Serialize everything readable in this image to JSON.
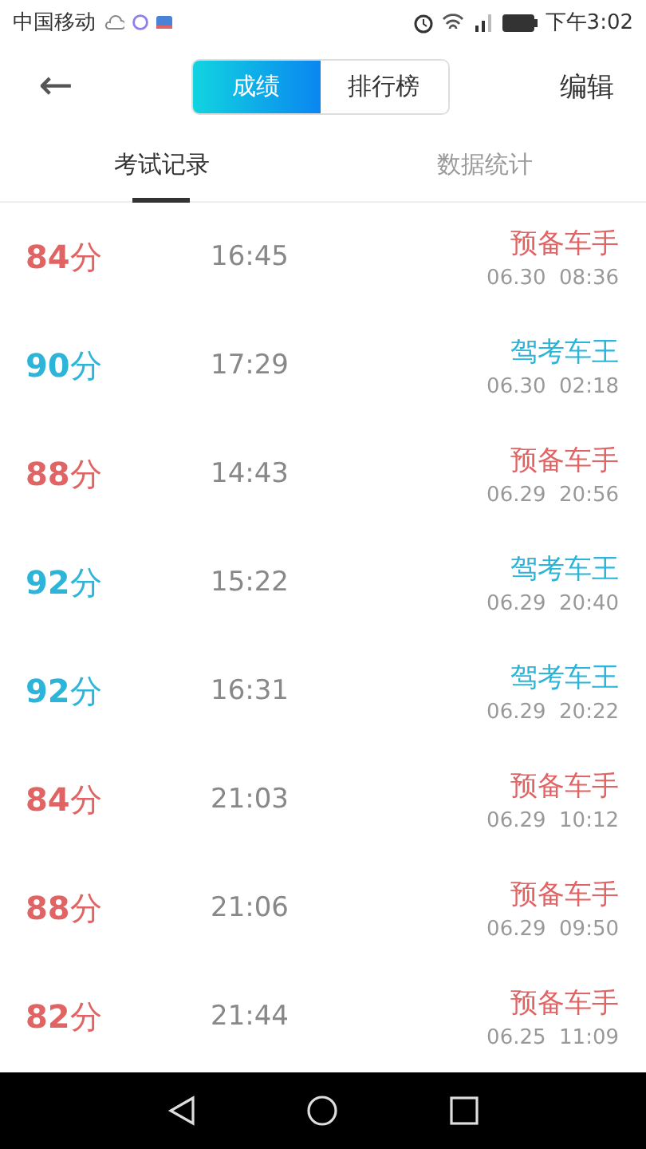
{
  "status_bar": {
    "carrier": "中国移动",
    "time": "下午3:02"
  },
  "header": {
    "back": "←",
    "segments": [
      {
        "label": "成绩",
        "selected": true
      },
      {
        "label": "排行榜",
        "selected": false
      }
    ],
    "action": "编辑"
  },
  "tabs": [
    {
      "label": "考试记录",
      "selected": true
    },
    {
      "label": "数据统计",
      "selected": false
    }
  ],
  "records": [
    {
      "score": "**84**分",
      "duration": "16:45",
      "title": "预备车手",
      "date": "06.30  08:36",
      "color": "#e06464"
    },
    {
      "score": "**90**分",
      "duration": "17:29",
      "title": "驾考车王",
      "date": "06.30  02:18",
      "color": "#2db4d9"
    },
    {
      "score": "**88**分",
      "duration": "14:43",
      "title": "预备车手",
      "date": "06.29  20:56",
      "color": "#e06464"
    },
    {
      "score": "**92**分",
      "duration": "15:22",
      "title": "驾考车王",
      "date": "06.29  20:40",
      "color": "#2db4d9"
    },
    {
      "score": "**92**分",
      "duration": "16:31",
      "title": "驾考车王",
      "date": "06.29  20:22",
      "color": "#2db4d9"
    },
    {
      "score": "**84**分",
      "duration": "21:03",
      "title": "预备车手",
      "date": "06.29  10:12",
      "color": "#e06464"
    },
    {
      "score": "**88**分",
      "duration": "21:06",
      "title": "预备车手",
      "date": "06.29  09:50",
      "color": "#e06464"
    },
    {
      "score": "**82**分",
      "duration": "21:44",
      "title": "预备车手",
      "date": "06.25  11:09",
      "color": "#e06464"
    }
  ]
}
